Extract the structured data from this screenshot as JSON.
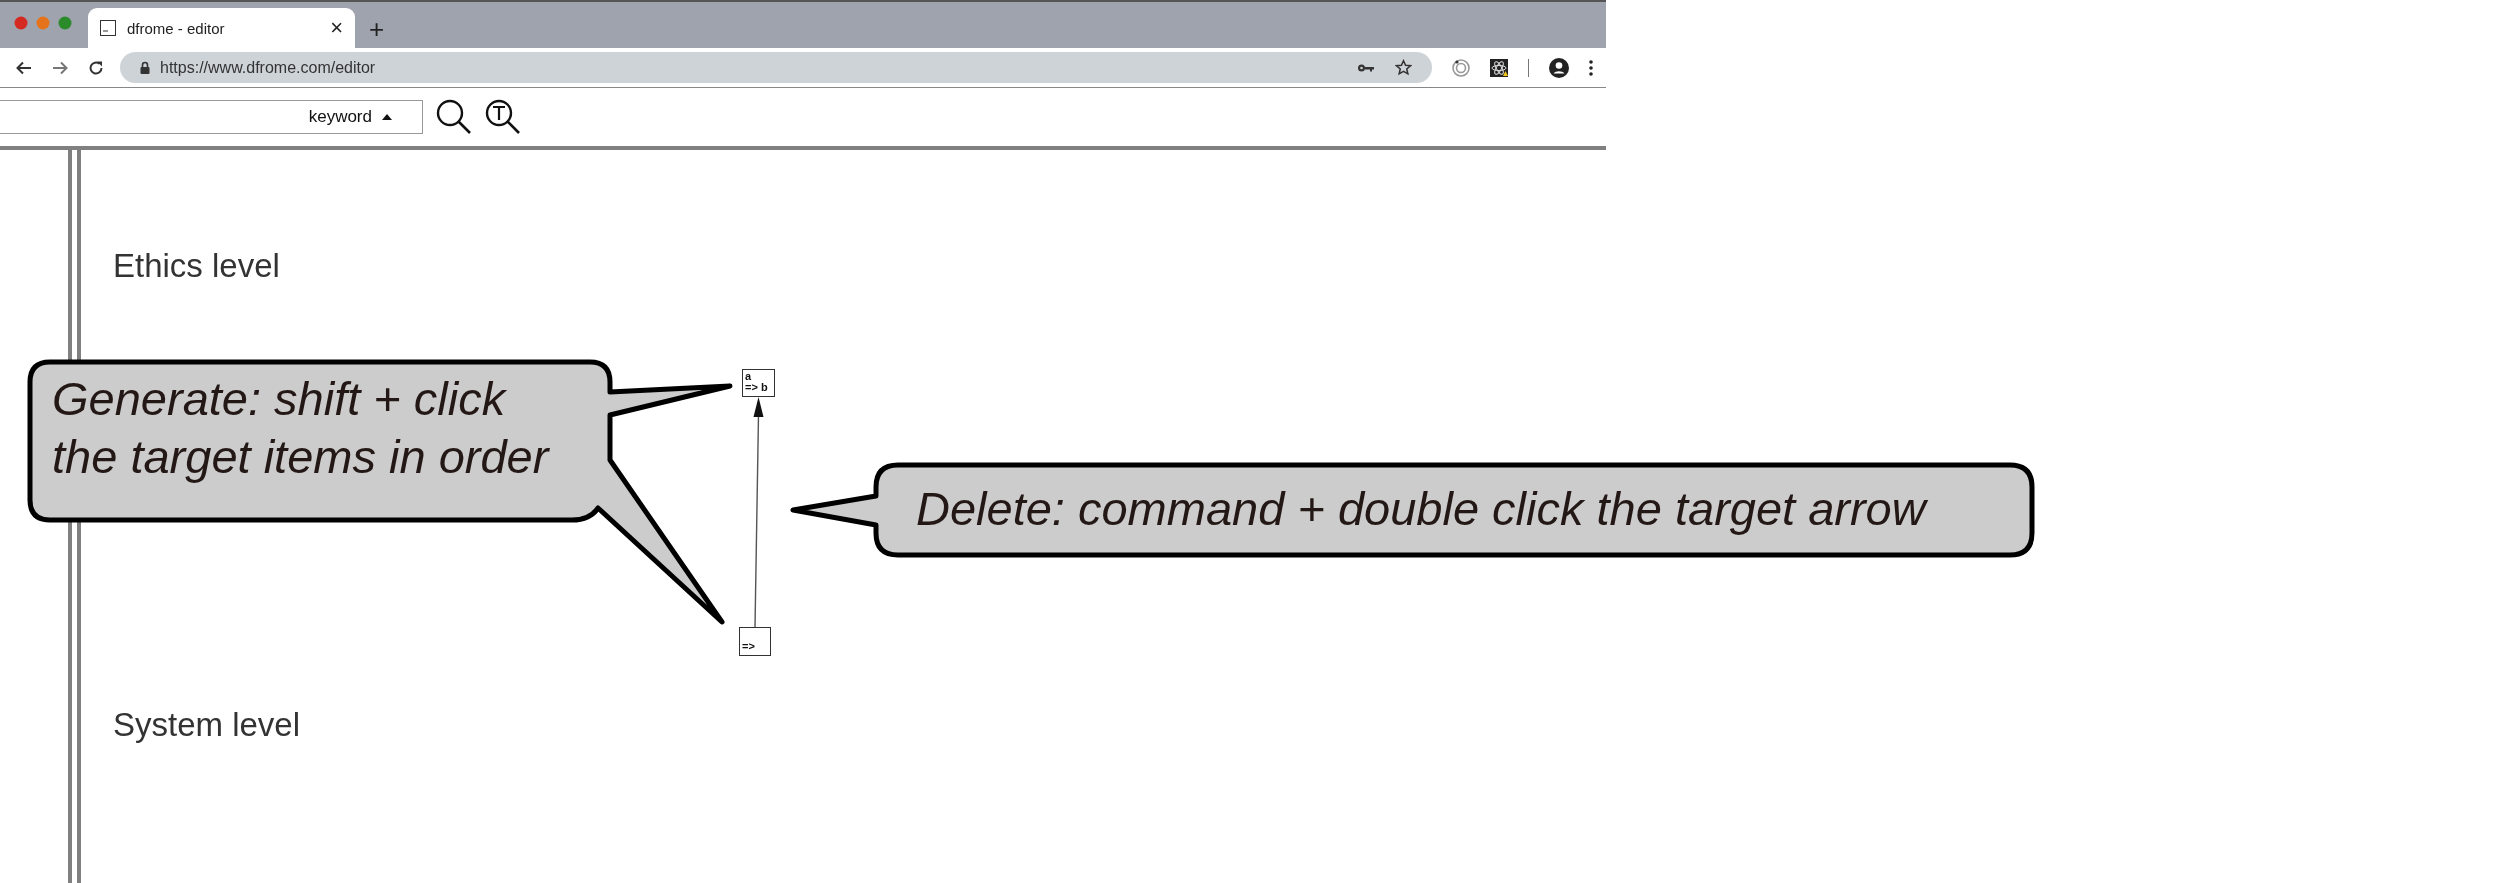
{
  "browser": {
    "tab": {
      "title": "dfrome - editor",
      "close": "×",
      "selected": true
    },
    "new_tab": "+",
    "address": "https://www.dfrome.com/editor"
  },
  "toolbar": {
    "search": {
      "mode": "keyword"
    }
  },
  "canvas": {
    "levels": [
      {
        "label": "Ethics level"
      },
      {
        "label": "System level"
      }
    ],
    "nodes": [
      {
        "lines": [
          "a",
          "=> b"
        ]
      },
      {
        "lines": [
          "=>"
        ]
      }
    ],
    "edges": [
      {
        "kind": "arrow"
      }
    ]
  },
  "callouts": [
    {
      "lines": [
        "Generate: shift + click",
        "the target items in order"
      ]
    },
    {
      "lines": [
        "Delete: command + double click the target arrow"
      ]
    }
  ]
}
